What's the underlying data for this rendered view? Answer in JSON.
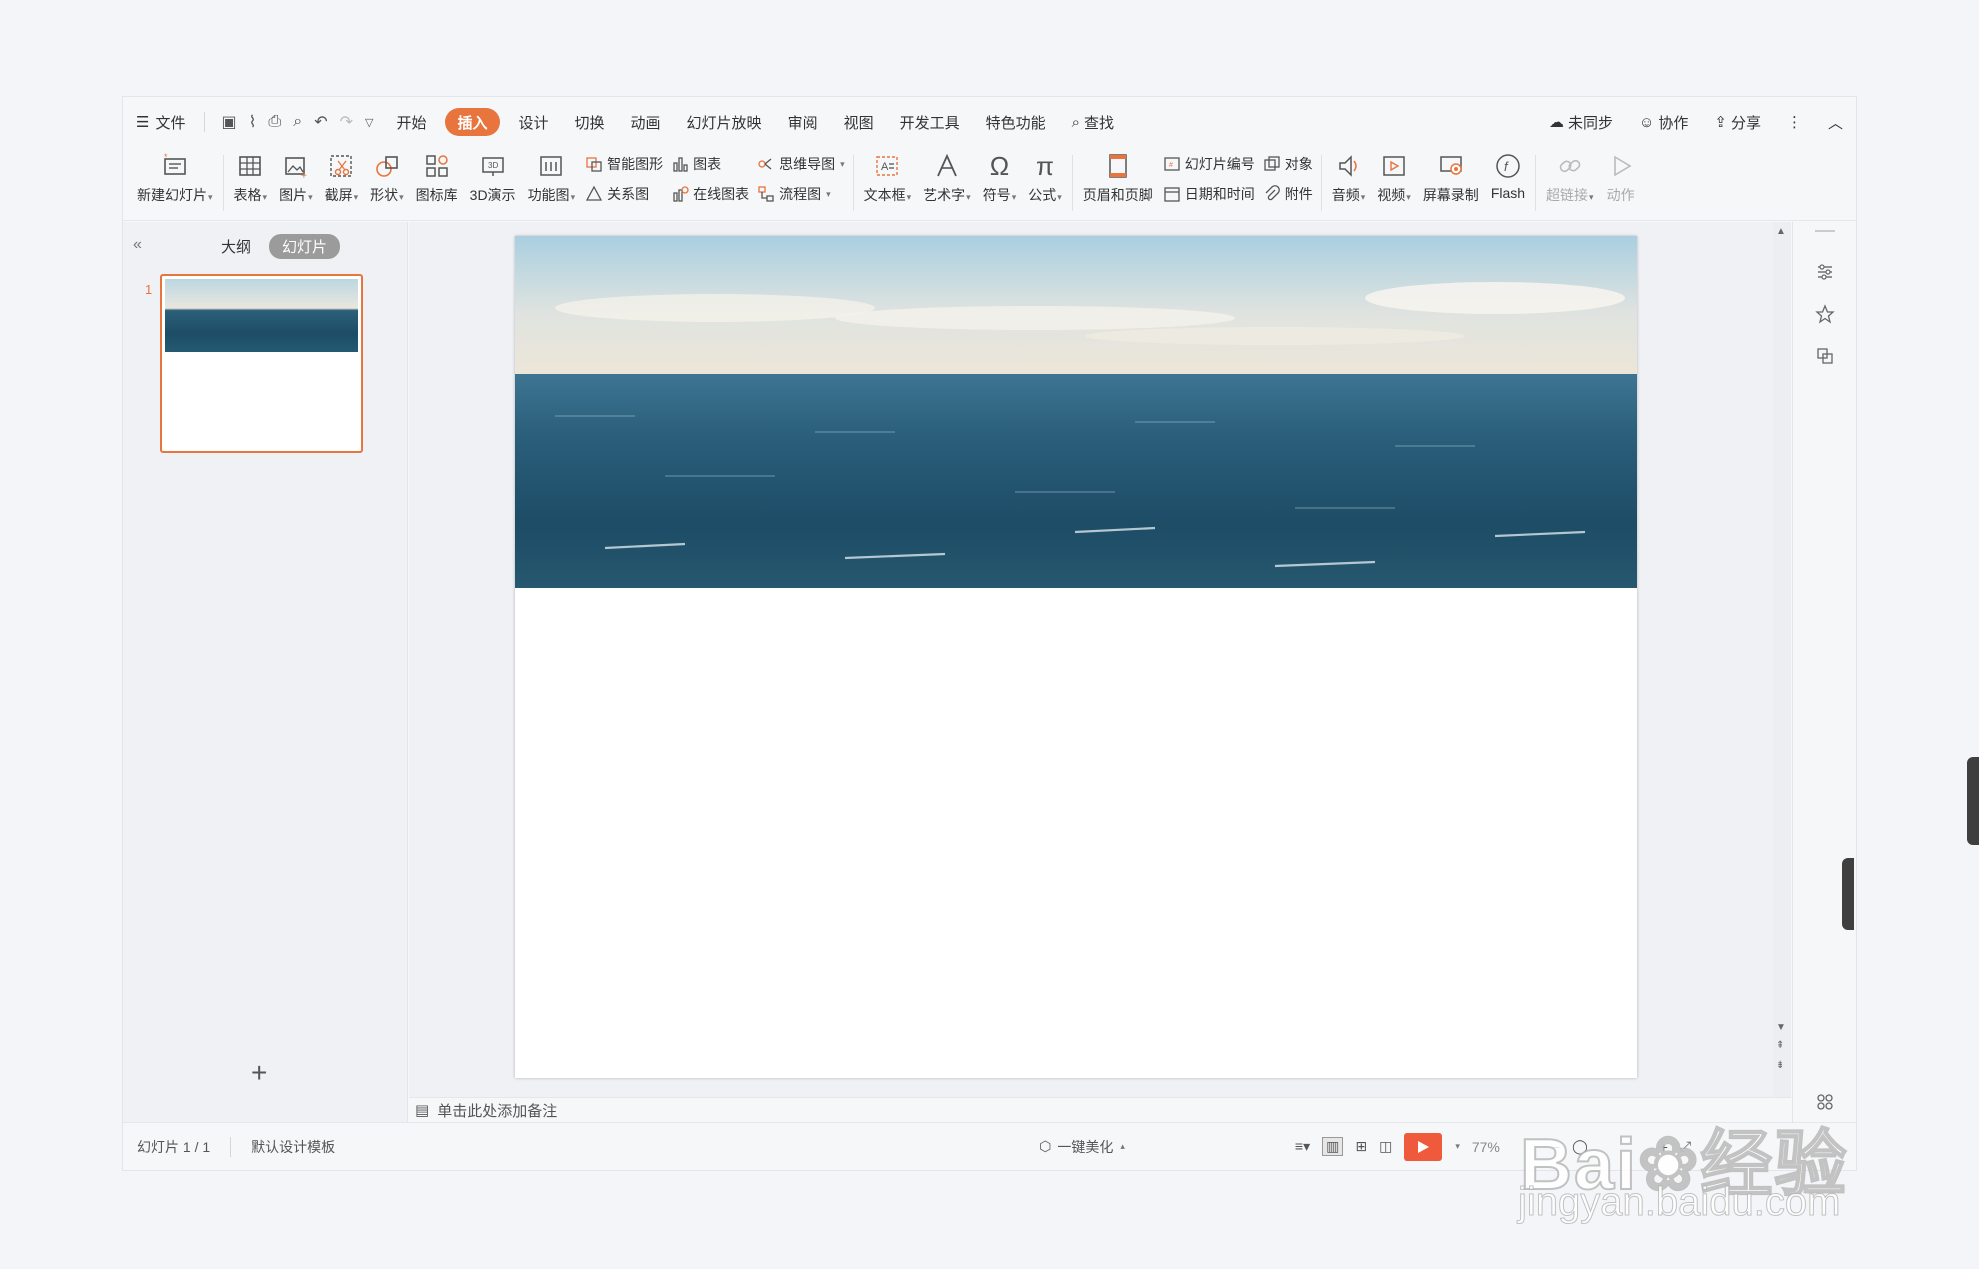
{
  "menu": {
    "file": "文件",
    "tabs": [
      "开始",
      "插入",
      "设计",
      "切换",
      "动画",
      "幻灯片放映",
      "审阅",
      "视图",
      "开发工具",
      "特色功能"
    ],
    "active_tab": "插入",
    "search": "查找",
    "sync": "未同步",
    "collab": "协作",
    "share": "分享"
  },
  "ribbon": {
    "new_slide": "新建幻灯片",
    "table": "表格",
    "picture": "图片",
    "screenshot": "截屏",
    "shape": "形状",
    "icon_lib": "图标库",
    "demo3d": "3D演示",
    "func_chart": "功能图",
    "smart_shape": "智能图形",
    "relation": "关系图",
    "chart": "图表",
    "online_chart": "在线图表",
    "mindmap": "思维导图",
    "flowchart": "流程图",
    "textbox": "文本框",
    "wordart": "艺术字",
    "symbol": "符号",
    "formula": "公式",
    "header_footer": "页眉和页脚",
    "slide_number": "幻灯片编号",
    "datetime": "日期和时间",
    "object": "对象",
    "attachment": "附件",
    "audio": "音频",
    "video": "视频",
    "screen_record": "屏幕录制",
    "flash": "Flash",
    "hyperlink": "超链接",
    "action": "动作"
  },
  "left_panel": {
    "outline_tab": "大纲",
    "slides_tab": "幻灯片",
    "slide_number": "1"
  },
  "notes_placeholder": "单击此处添加备注",
  "status": {
    "slide_count": "幻灯片 1 / 1",
    "template": "默认设计模板",
    "beautify": "一键美化",
    "zoom": "77%"
  },
  "watermark": {
    "brand": "Bai",
    "brand_cn": "经验",
    "url": "jingyan.baidu.com"
  },
  "colors": {
    "accent": "#e8743e",
    "play": "#f05a3c"
  }
}
